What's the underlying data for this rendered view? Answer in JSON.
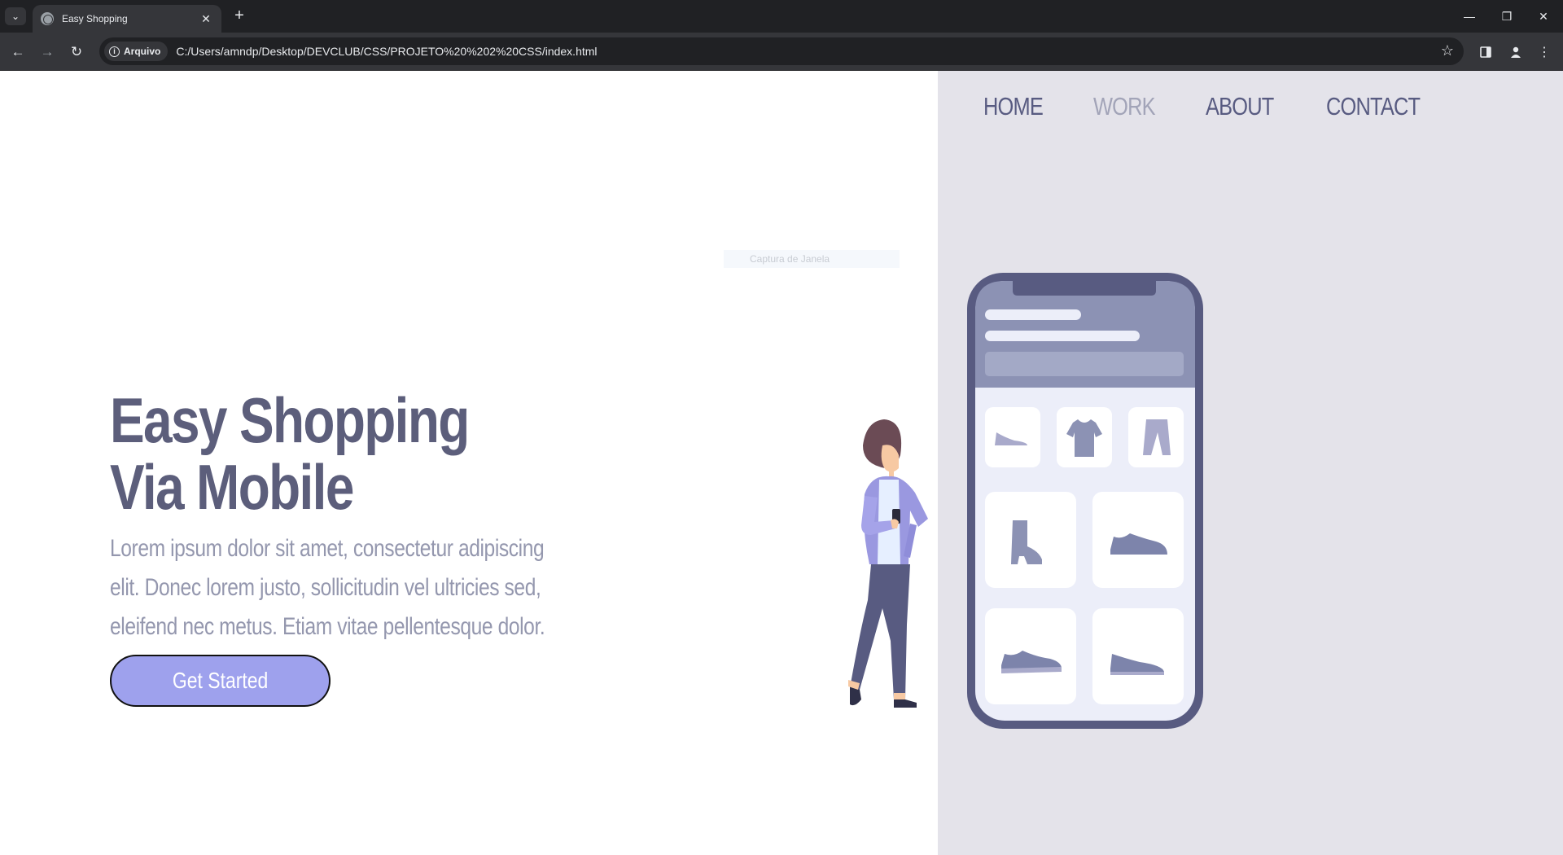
{
  "browser": {
    "tab_title": "Easy Shopping",
    "tab_close": "✕",
    "new_tab": "+",
    "security_chip": "Arquivo",
    "url": "C:/Users/amndp/Desktop/DEVCLUB/CSS/PROJETO%20%202%20CSS/index.html"
  },
  "nav": {
    "items": [
      {
        "label": "HOME"
      },
      {
        "label": "WORK"
      },
      {
        "label": "ABOUT"
      },
      {
        "label": "CONTACT"
      }
    ]
  },
  "hero": {
    "title_line1": "Easy Shopping",
    "title_line2": "Via Mobile",
    "text": "Lorem ipsum dolor sit amet, consectetur adipiscing elit. Donec lorem justo, sollicitudin vel ultricies sed, eleifend nec metus. Etiam vitae pellentesque dolor.",
    "cta_label": "Get Started"
  },
  "tooltip": "Captura de Janela",
  "colors": {
    "brand_text": "#5c5e7b",
    "accent_button": "#9ea1ed",
    "panel_bg": "#e4e3ea",
    "phone_frame": "#585b81"
  },
  "icons": {
    "phone_products": [
      "flat-shoe-icon",
      "tshirt-icon",
      "pants-icon",
      "boot-icon",
      "sneaker-icon",
      "sneaker-icon",
      "sneaker-icon"
    ]
  }
}
